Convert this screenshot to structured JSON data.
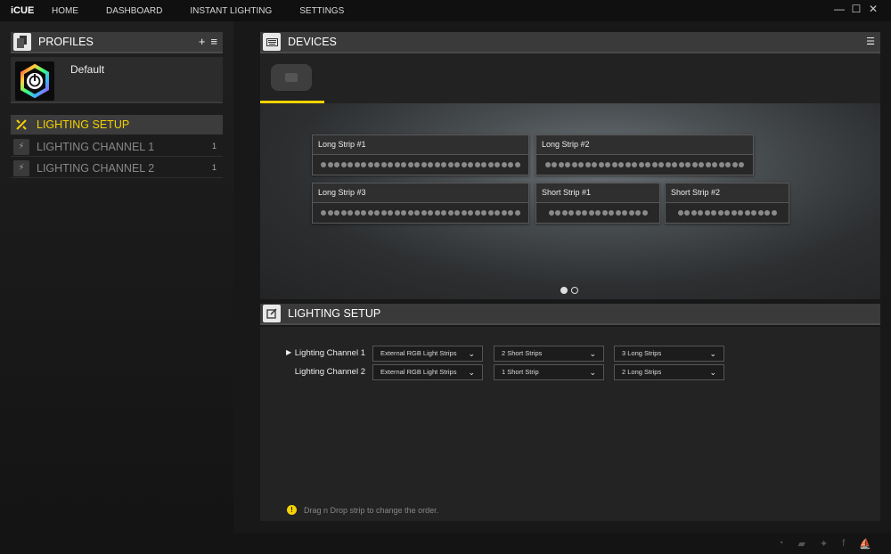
{
  "app": {
    "brand": "iCUE"
  },
  "nav": [
    "HOME",
    "DASHBOARD",
    "INSTANT LIGHTING",
    "SETTINGS"
  ],
  "window": {
    "minimize": "—",
    "maximize": "☐",
    "close": "✕"
  },
  "profiles": {
    "title": "PROFILES",
    "add": "+",
    "menu": "≡",
    "items": [
      {
        "name": "Default"
      }
    ]
  },
  "sidebar": {
    "lighting_setup": "LIGHTING SETUP",
    "channels": [
      {
        "label": "LIGHTING CHANNEL 1",
        "count": "1"
      },
      {
        "label": "LIGHTING CHANNEL 2",
        "count": "1"
      }
    ]
  },
  "devices": {
    "title": "DEVICES",
    "strips": [
      {
        "name": "Long Strip #1"
      },
      {
        "name": "Long Strip #2"
      },
      {
        "name": "Long Strip #3"
      },
      {
        "name": "Short Strip #1"
      },
      {
        "name": "Short Strip #2"
      }
    ],
    "page_count": 2,
    "current_page": 1
  },
  "lighting_setup": {
    "title": "LIGHTING SETUP",
    "rows": [
      {
        "label": "Lighting Channel 1",
        "type": "External RGB Light Strips",
        "short": "2 Short Strips",
        "long": "3 Long Strips"
      },
      {
        "label": "Lighting Channel 2",
        "type": "External RGB Light Strips",
        "short": "1 Short Strip",
        "long": "2 Long Strips"
      }
    ],
    "hint": "Drag n Drop strip to change the order."
  },
  "colors": {
    "accent": "#f5d200",
    "background": "#181818"
  }
}
